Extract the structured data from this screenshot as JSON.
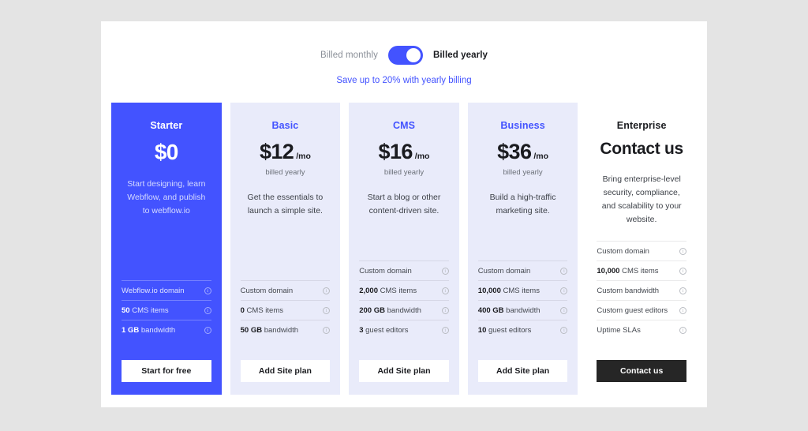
{
  "billing": {
    "monthly_label": "Billed monthly",
    "yearly_label": "Billed yearly",
    "toggle_state": "yearly",
    "save_note": "Save up to 20% with yearly billing",
    "accent_color": "#4353ff"
  },
  "plans": [
    {
      "name": "Starter",
      "price": "$0",
      "per": "",
      "billed_sub": "",
      "description": "Start designing, learn Webflow, and publish to webflow.io",
      "cta": "Start for free",
      "cta_style": "light",
      "highlighted": true,
      "features": [
        {
          "strong": "",
          "text": "Webflow.io domain",
          "icon": "info-icon"
        },
        {
          "strong": "50",
          "text": "CMS items",
          "icon": "info-icon"
        },
        {
          "strong": "1 GB",
          "text": "bandwidth",
          "icon": "info-icon"
        }
      ]
    },
    {
      "name": "Basic",
      "price": "$12",
      "per": "/mo",
      "billed_sub": "billed yearly",
      "description": "Get the essentials to launch a simple site.",
      "cta": "Add Site plan",
      "cta_style": "light",
      "highlighted": false,
      "features": [
        {
          "strong": "",
          "text": "Custom domain",
          "icon": "info-icon"
        },
        {
          "strong": "0",
          "text": "CMS items",
          "icon": "info-icon"
        },
        {
          "strong": "50 GB",
          "text": "bandwidth",
          "icon": "info-icon"
        }
      ]
    },
    {
      "name": "CMS",
      "price": "$16",
      "per": "/mo",
      "billed_sub": "billed yearly",
      "description": "Start a blog or other content-driven site.",
      "cta": "Add Site plan",
      "cta_style": "light",
      "highlighted": false,
      "features": [
        {
          "strong": "",
          "text": "Custom domain",
          "icon": "info-icon"
        },
        {
          "strong": "2,000",
          "text": "CMS items",
          "icon": "info-icon"
        },
        {
          "strong": "200 GB",
          "text": "bandwidth",
          "icon": "info-icon"
        },
        {
          "strong": "3",
          "text": "guest editors",
          "icon": "info-icon"
        }
      ]
    },
    {
      "name": "Business",
      "price": "$36",
      "per": "/mo",
      "billed_sub": "billed yearly",
      "description": "Build a high-traffic marketing site.",
      "cta": "Add Site plan",
      "cta_style": "light",
      "highlighted": false,
      "features": [
        {
          "strong": "",
          "text": "Custom domain",
          "icon": "info-icon"
        },
        {
          "strong": "10,000",
          "text": "CMS items",
          "icon": "info-icon"
        },
        {
          "strong": "400 GB",
          "text": "bandwidth",
          "icon": "info-icon"
        },
        {
          "strong": "10",
          "text": "guest editors",
          "icon": "info-icon"
        }
      ]
    },
    {
      "name": "Enterprise",
      "price": "Contact us",
      "per": "",
      "billed_sub": "",
      "description": "Bring enterprise-level security, compliance, and scalability to your website.",
      "cta": "Contact us",
      "cta_style": "dark",
      "highlighted": false,
      "features": [
        {
          "strong": "",
          "text": "Custom domain",
          "icon": "info-icon"
        },
        {
          "strong": "10,000",
          "text": "CMS items",
          "icon": "info-icon"
        },
        {
          "strong": "",
          "text": "Custom bandwidth",
          "icon": "info-icon"
        },
        {
          "strong": "",
          "text": "Custom guest editors",
          "icon": "info-icon"
        },
        {
          "strong": "",
          "text": "Uptime SLAs",
          "icon": "info-icon"
        }
      ]
    }
  ]
}
